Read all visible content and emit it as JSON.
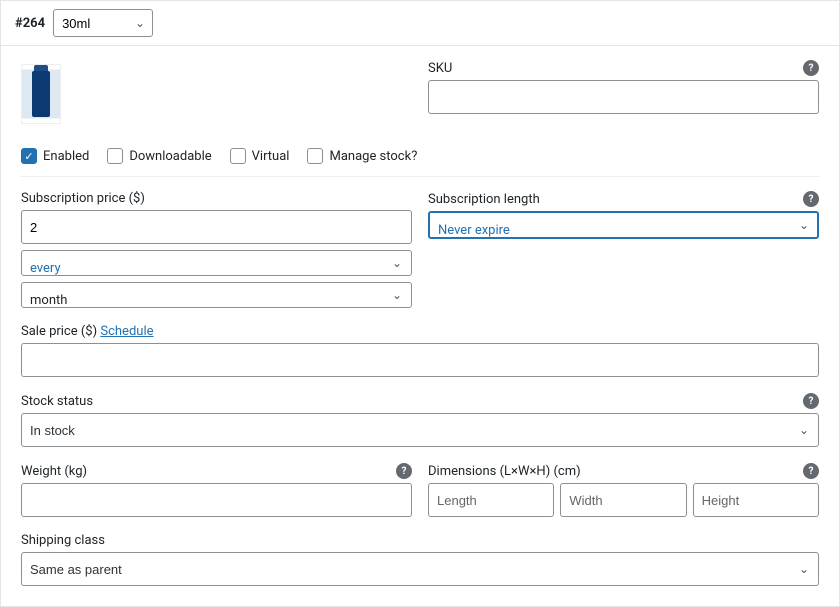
{
  "variation": {
    "id_label": "#264",
    "variant_select": "30ml"
  },
  "sku": {
    "label": "SKU",
    "value": ""
  },
  "checks": {
    "enabled": {
      "label": "Enabled",
      "checked": true
    },
    "downloadable": {
      "label": "Downloadable",
      "checked": false
    },
    "virtual": {
      "label": "Virtual",
      "checked": false
    },
    "manage_stock": {
      "label": "Manage stock?",
      "checked": false
    }
  },
  "subscription": {
    "price_label": "Subscription price ($)",
    "price_value": "2",
    "interval": "every",
    "period": "month",
    "length_label": "Subscription length",
    "length_value": "Never expire"
  },
  "sale": {
    "label_prefix": "Sale price ($) ",
    "schedule_link": "Schedule",
    "value": ""
  },
  "stock": {
    "label": "Stock status",
    "value": "In stock"
  },
  "weight": {
    "label": "Weight (kg)",
    "value": ""
  },
  "dimensions": {
    "label": "Dimensions (L×W×H) (cm)",
    "length_ph": "Length",
    "width_ph": "Width",
    "height_ph": "Height"
  },
  "shipping_class": {
    "label": "Shipping class",
    "value": "Same as parent"
  }
}
